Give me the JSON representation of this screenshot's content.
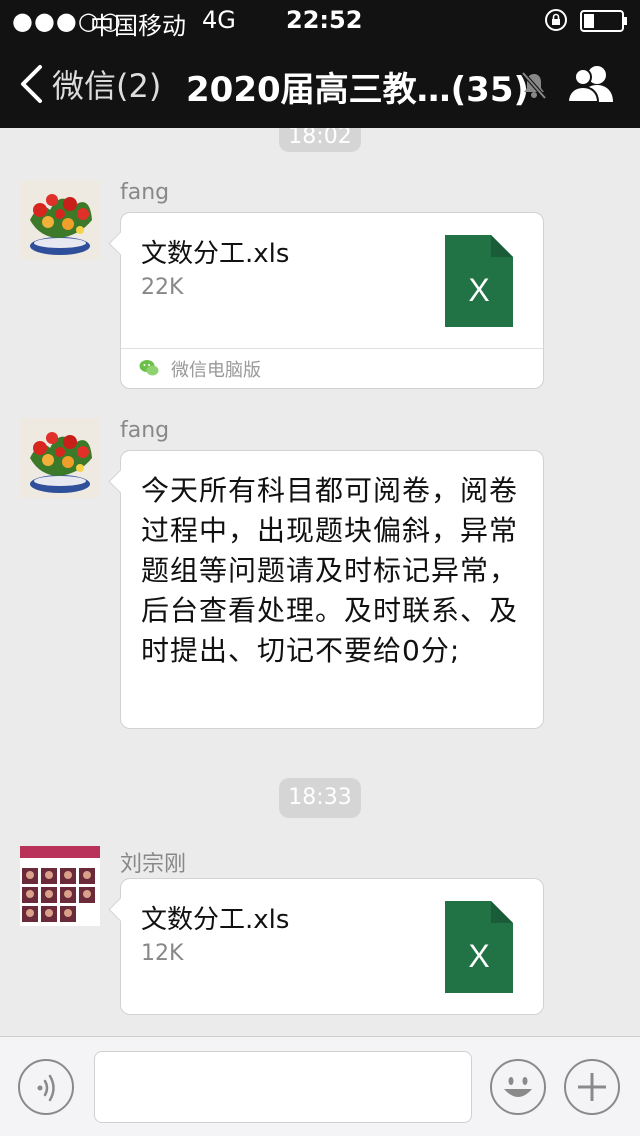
{
  "status_bar": {
    "signal": "●●●○○",
    "carrier": "中国移动",
    "network": "4G",
    "time": "22:52"
  },
  "nav": {
    "back_label": "微信(2)",
    "title": "2020届高三教…(35)"
  },
  "messages": [
    {
      "timestamp": "18:02",
      "sender": "fang",
      "type": "file",
      "file_name": "文数分工.xls",
      "file_size": "22K",
      "source": "微信电脑版"
    },
    {
      "sender": "fang",
      "type": "text",
      "text": "今天所有科目都可阅卷，阅卷过程中，出现题块偏斜，异常题组等问题请及时标记异常，后台查看处理。及时联系、及时提出、切记不要给0分;"
    },
    {
      "timestamp": "18:33",
      "sender": "刘宗刚",
      "type": "file",
      "file_name": "文数分工.xls",
      "file_size": "12K"
    }
  ],
  "icons": {
    "excel_letter": "X",
    "excel_color": "#217346"
  }
}
